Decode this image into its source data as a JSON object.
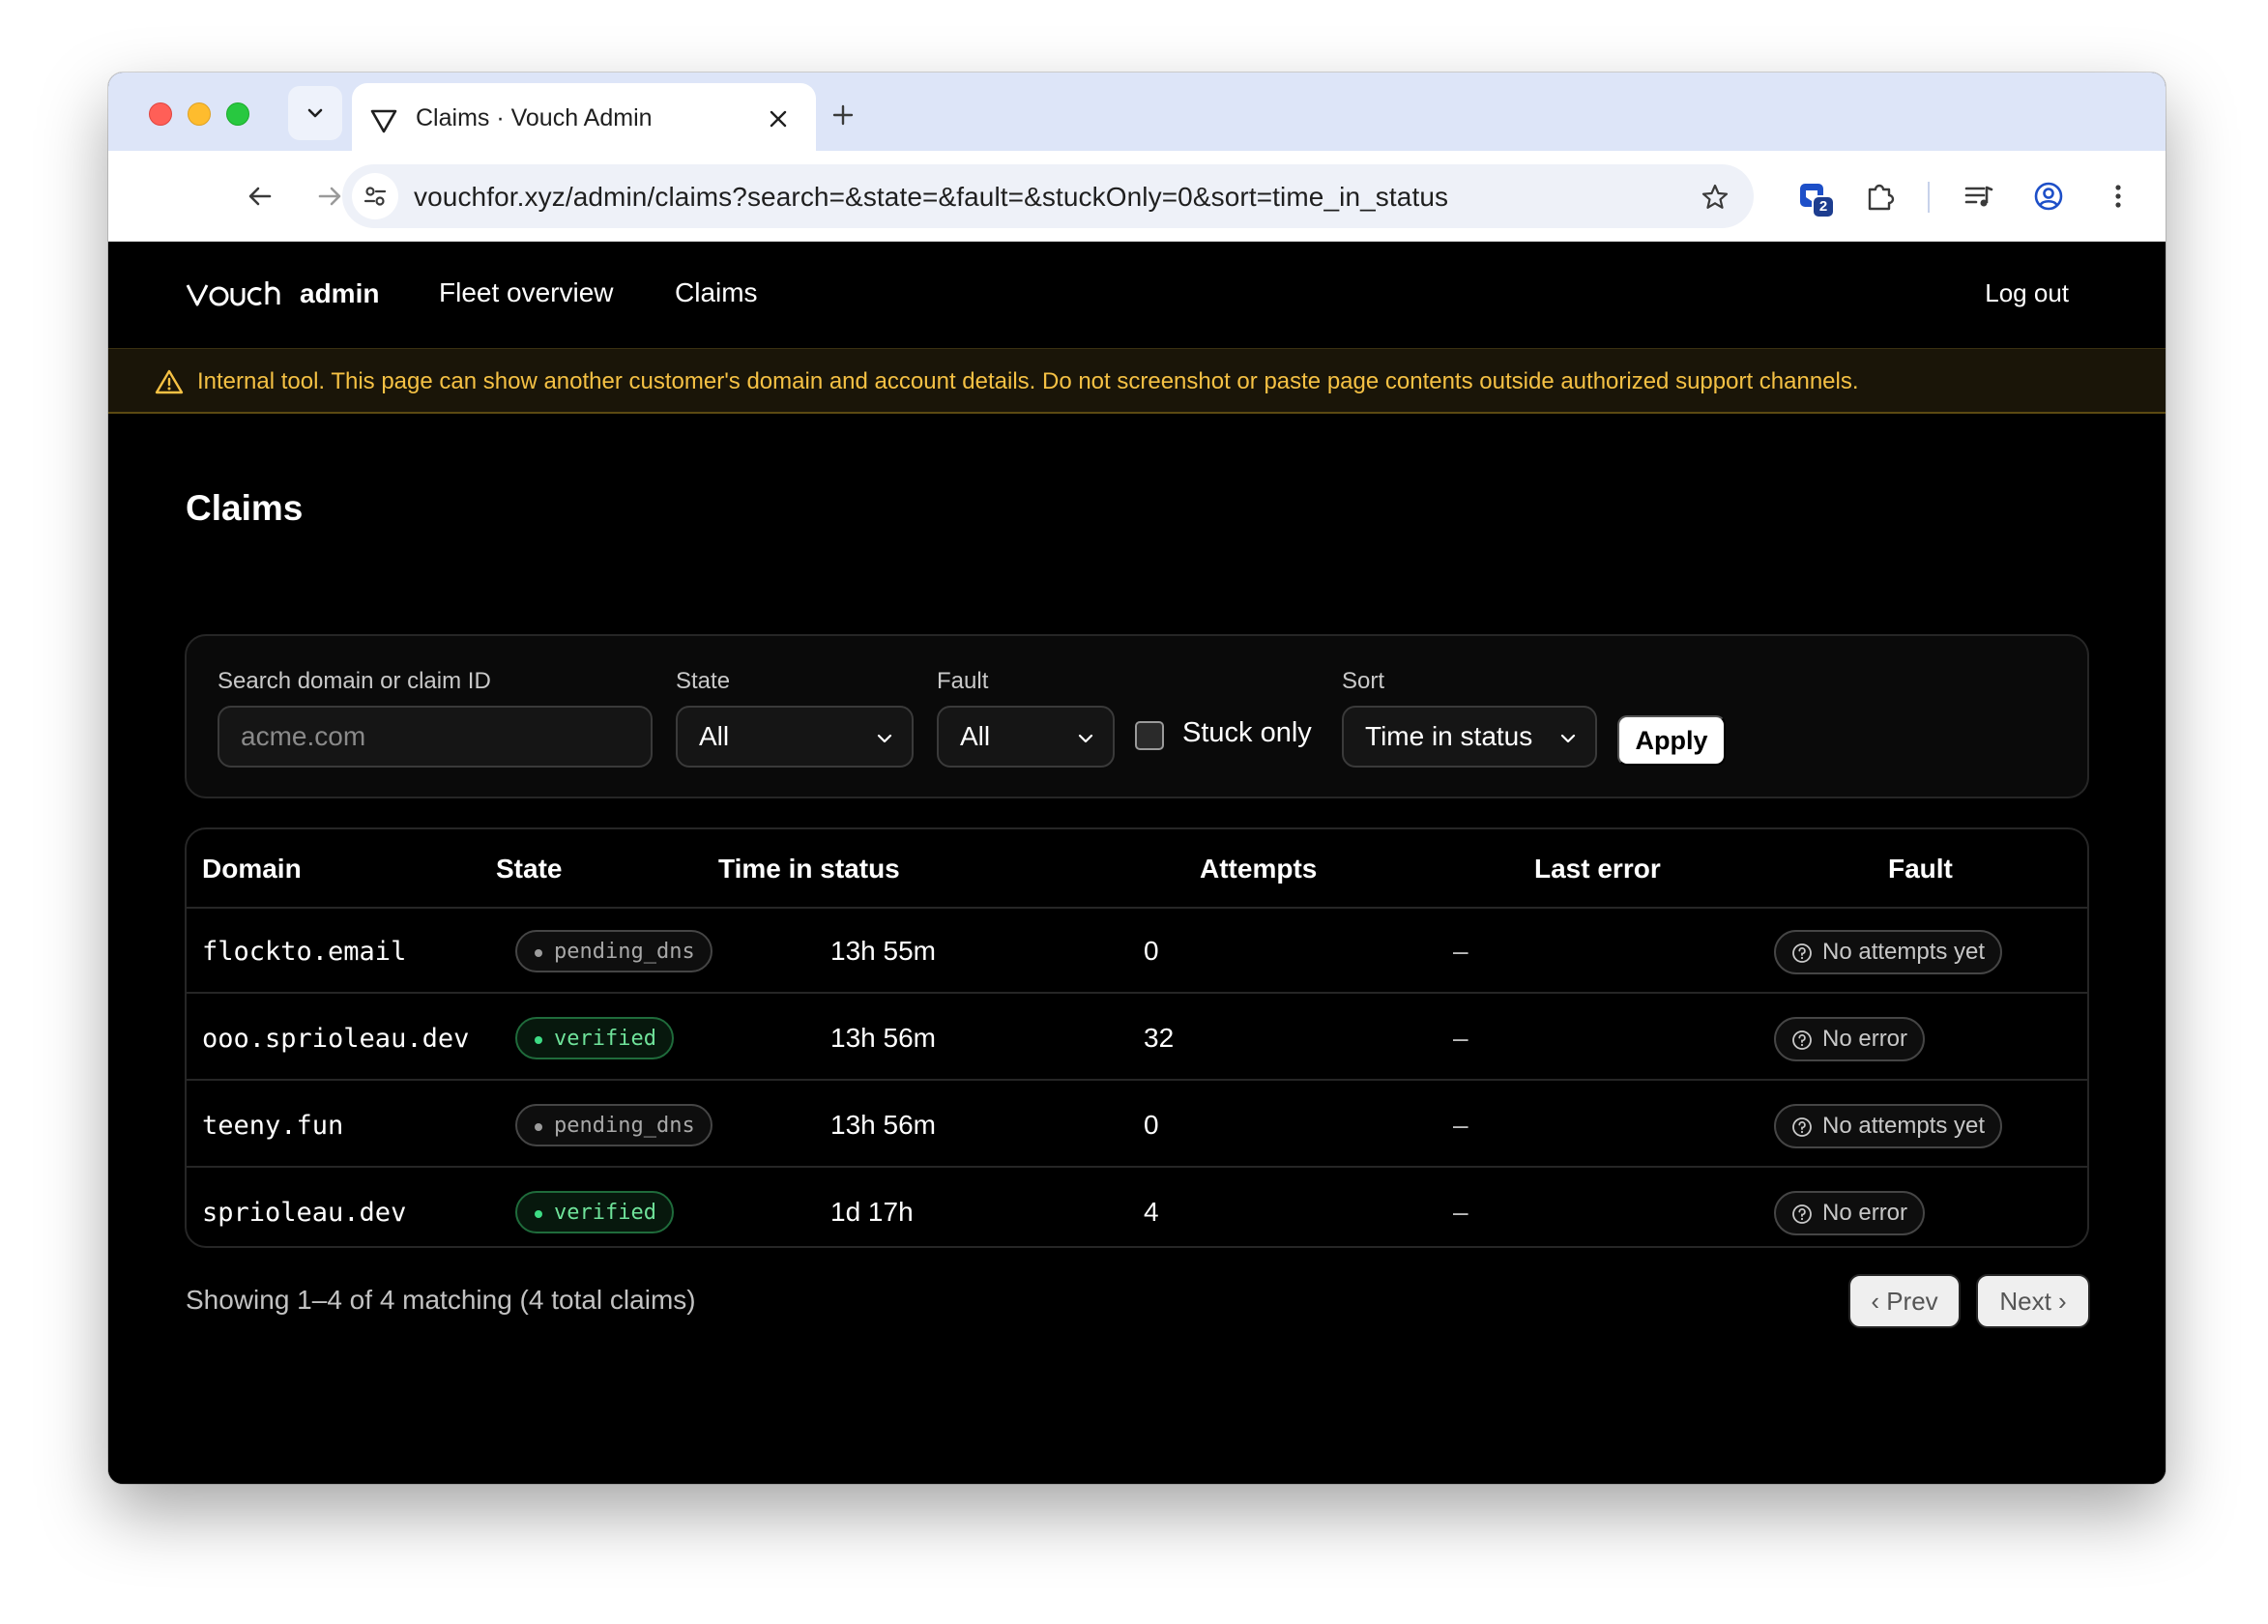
{
  "browser": {
    "tab_title": "Claims · Vouch Admin",
    "url": "vouchfor.xyz/admin/claims?search=&state=&fault=&stuckOnly=0&sort=time_in_status",
    "extension_badge": "2"
  },
  "nav": {
    "logo_word": "admin",
    "links": [
      "Fleet overview",
      "Claims"
    ],
    "logout": "Log out"
  },
  "banner": {
    "text": "Internal tool. This page can show another customer's domain and account details. Do not screenshot or paste page contents outside authorized support channels."
  },
  "page": {
    "title": "Claims"
  },
  "filters": {
    "search_label": "Search domain or claim ID",
    "search_placeholder": "acme.com",
    "state_label": "State",
    "state_value": "All",
    "fault_label": "Fault",
    "fault_value": "All",
    "stuck_label": "Stuck only",
    "stuck_checked": false,
    "sort_label": "Sort",
    "sort_value": "Time in status",
    "apply": "Apply"
  },
  "table": {
    "headers": [
      "Domain",
      "State",
      "Time in status",
      "Attempts",
      "Last error",
      "Fault"
    ],
    "rows": [
      {
        "domain": "flockto.email",
        "state": "pending_dns",
        "time": "13h 55m",
        "attempts": "0",
        "last_error": "–",
        "fault": "No attempts yet"
      },
      {
        "domain": "ooo.sprioleau.dev",
        "state": "verified",
        "time": "13h 56m",
        "attempts": "32",
        "last_error": "–",
        "fault": "No error"
      },
      {
        "domain": "teeny.fun",
        "state": "pending_dns",
        "time": "13h 56m",
        "attempts": "0",
        "last_error": "–",
        "fault": "No attempts yet"
      },
      {
        "domain": "sprioleau.dev",
        "state": "verified",
        "time": "1d 17h",
        "attempts": "4",
        "last_error": "–",
        "fault": "No error"
      }
    ]
  },
  "footer": {
    "showing": "Showing 1–4 of 4 matching (4 total claims)",
    "prev": "‹ Prev",
    "next": "Next ›"
  },
  "colors": {
    "warning": "#f5c144",
    "verified": "#6fe39a",
    "accent": "#1d3d8f"
  }
}
